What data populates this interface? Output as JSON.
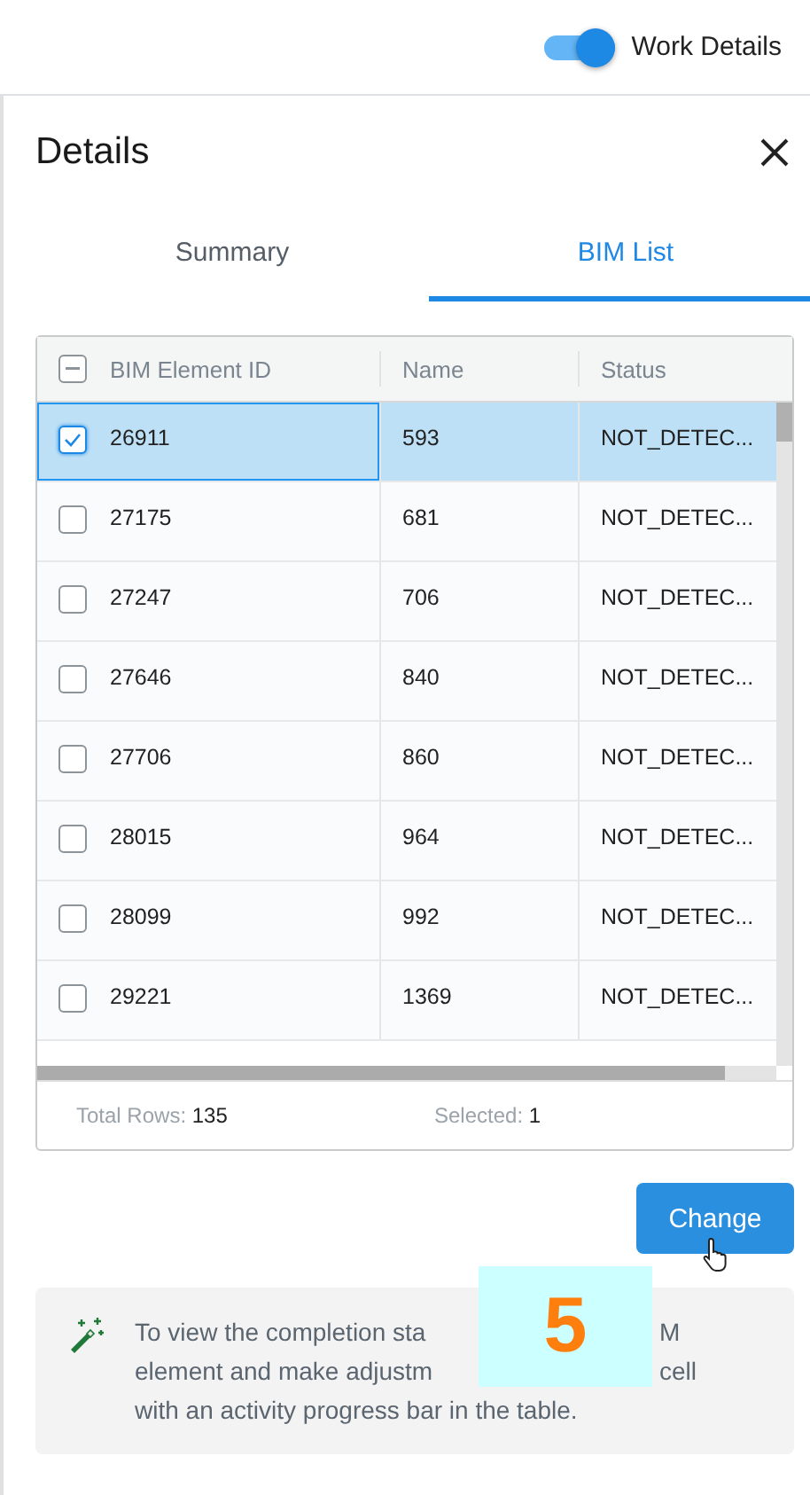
{
  "topbar": {
    "toggle": {
      "label": "Work Details",
      "on": true
    }
  },
  "panel": {
    "title": "Details",
    "tabs": [
      {
        "label": "Summary",
        "selected": false
      },
      {
        "label": "BIM List",
        "selected": true
      }
    ],
    "table": {
      "select_all": {
        "indeterminate": true
      },
      "columns": [
        "BIM Element ID",
        "Name",
        "Status"
      ],
      "rows": [
        {
          "id": "26911",
          "name": "593",
          "status": "NOT_DETEC...",
          "selected": true
        },
        {
          "id": "27175",
          "name": "681",
          "status": "NOT_DETEC...",
          "selected": false
        },
        {
          "id": "27247",
          "name": "706",
          "status": "NOT_DETEC...",
          "selected": false
        },
        {
          "id": "27646",
          "name": "840",
          "status": "NOT_DETEC...",
          "selected": false
        },
        {
          "id": "27706",
          "name": "860",
          "status": "NOT_DETEC...",
          "selected": false
        },
        {
          "id": "28015",
          "name": "964",
          "status": "NOT_DETEC...",
          "selected": false
        },
        {
          "id": "28099",
          "name": "992",
          "status": "NOT_DETEC...",
          "selected": false
        },
        {
          "id": "29221",
          "name": "1369",
          "status": "NOT_DETEC...",
          "selected": false
        }
      ],
      "footer": {
        "total_label": "Total Rows:",
        "total": "135",
        "selected_label": "Selected:",
        "selected": "1"
      }
    },
    "button": "Change",
    "tip": {
      "lines": [
        {
          "before": "To view the completion sta",
          "after": "M"
        },
        {
          "before": "element and make adjustm",
          "after": "cell"
        },
        {
          "before": "with an activity progress bar in the table."
        }
      ]
    },
    "step_badge": "5"
  }
}
